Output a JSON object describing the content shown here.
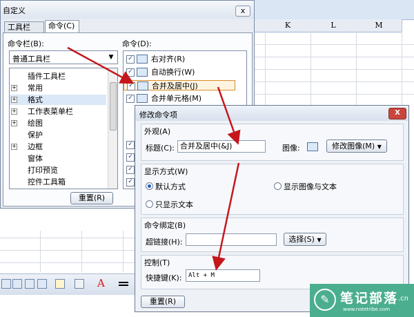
{
  "sheet": {
    "columns": [
      "K",
      "L",
      "M"
    ]
  },
  "customize": {
    "title": "自定义",
    "close": "x",
    "tabs": [
      "工具栏(T)",
      "命令(C)"
    ],
    "toolbars_label": "命令栏(B):",
    "toolbar_selected": "普通工具栏",
    "commands_label": "命令(D):",
    "toolbar_items": [
      {
        "label": "插件工具栏",
        "expand": false
      },
      {
        "label": "常用",
        "expand": true
      },
      {
        "label": "格式",
        "expand": true
      },
      {
        "label": "工作表菜单栏",
        "expand": true
      },
      {
        "label": "绘图",
        "expand": true
      },
      {
        "label": "保护",
        "expand": false
      },
      {
        "label": "边框",
        "expand": true
      },
      {
        "label": "窗体",
        "expand": false
      },
      {
        "label": "打印预览",
        "expand": false
      },
      {
        "label": "控件工具箱",
        "expand": false
      }
    ],
    "commands": [
      "右对齐(R)",
      "自动换行(W)",
      "合并及居中(J)",
      "合并单元格(M)"
    ],
    "reset": "重置(R)"
  },
  "modify": {
    "title": "修改命令项",
    "close": "X",
    "appearance": {
      "label": "外观(A)",
      "title_label": "标题(C):",
      "title_value": "合并及居中(&J)",
      "image_label": "图像:",
      "change_image": "修改图像(M)"
    },
    "display": {
      "label": "显示方式(W)",
      "opt_default": "默认方式",
      "opt_image_text": "显示图像与文本",
      "opt_text_only": "只显示文本"
    },
    "binding": {
      "label": "命令绑定(B)",
      "link_label": "超链接(H):",
      "select_button": "选择(S)"
    },
    "control": {
      "label": "控制(T)",
      "shortcut_label": "快捷键(K):",
      "shortcut_value": "Alt + M"
    },
    "reset": "重置(R)"
  },
  "watermark": {
    "name": "笔记部落",
    "suffix": ".cn",
    "url": "www.notetribe.com"
  },
  "colors": {
    "arrow": "#c4161c",
    "accent": "#4bae8e"
  }
}
